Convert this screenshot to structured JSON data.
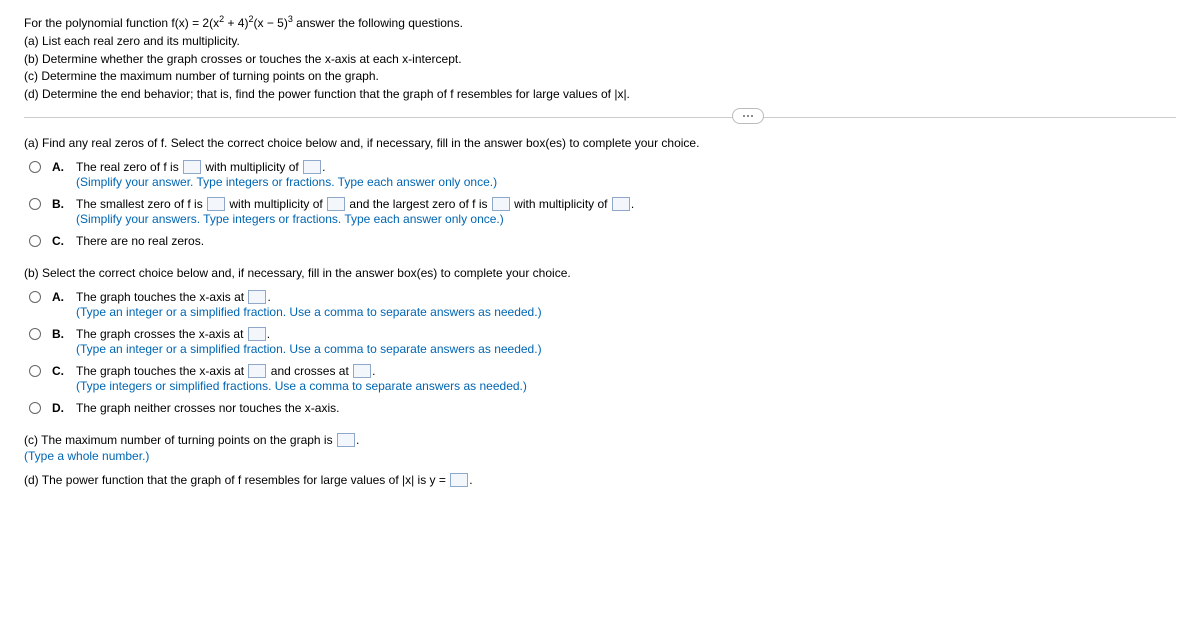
{
  "intro": {
    "line1_pre": "For the polynomial function f(x) = 2",
    "line1_paren": "(x",
    "line1_sq": "2",
    "line1_mid": " + 4)",
    "line1_exp1": "2",
    "line1_mid2": "(x − 5)",
    "line1_exp2": "3",
    "line1_post": " answer the following questions.",
    "a": "(a) List each real zero and its multiplicity.",
    "b": "(b) Determine whether the graph crosses or touches the x-axis at each x-intercept.",
    "c": "(c) Determine the maximum number of turning points on the graph.",
    "d": "(d) Determine the end behavior; that is, find the power function that the graph of f resembles for large values of |x|."
  },
  "qa": {
    "prompt": "(a) Find any real zeros of f. Select the correct choice below and, if necessary, fill in the answer box(es) to complete your choice.",
    "A": {
      "t1": "The real zero of f is ",
      "t2": " with multiplicity of ",
      "t3": ".",
      "hint": "(Simplify your answer. Type integers or fractions. Type each answer only once.)"
    },
    "B": {
      "t1": "The smallest zero of f is ",
      "t2": " with multiplicity of ",
      "t3": " and the largest zero of f is ",
      "t4": " with multiplicity of ",
      "t5": ".",
      "hint": "(Simplify your answers. Type integers or fractions. Type each answer only once.)"
    },
    "C": {
      "t1": "There are no real zeros."
    }
  },
  "qb": {
    "prompt": "(b) Select the correct choice below and, if necessary, fill in the answer box(es) to complete your choice.",
    "A": {
      "t1": "The graph touches the x-axis at ",
      "t2": ".",
      "hint": "(Type an integer or a simplified fraction. Use a comma to separate answers as needed.)"
    },
    "B": {
      "t1": "The graph crosses the x-axis at ",
      "t2": ".",
      "hint": "(Type an integer or a simplified fraction. Use a comma to separate answers as needed.)"
    },
    "C": {
      "t1": "The graph touches the x-axis at ",
      "t2": " and crosses at ",
      "t3": ".",
      "hint": "(Type integers or simplified fractions. Use a comma to separate answers as needed.)"
    },
    "D": {
      "t1": "The graph neither crosses nor touches the x-axis."
    }
  },
  "qc": {
    "t1": "(c) The maximum number of turning points on the graph is ",
    "t2": ".",
    "hint": "(Type a whole number.)"
  },
  "qd": {
    "t1": "(d) The power function that the graph of f resembles for large values of |x| is y = ",
    "t2": "."
  },
  "letters": {
    "A": "A.",
    "B": "B.",
    "C": "C.",
    "D": "D."
  }
}
